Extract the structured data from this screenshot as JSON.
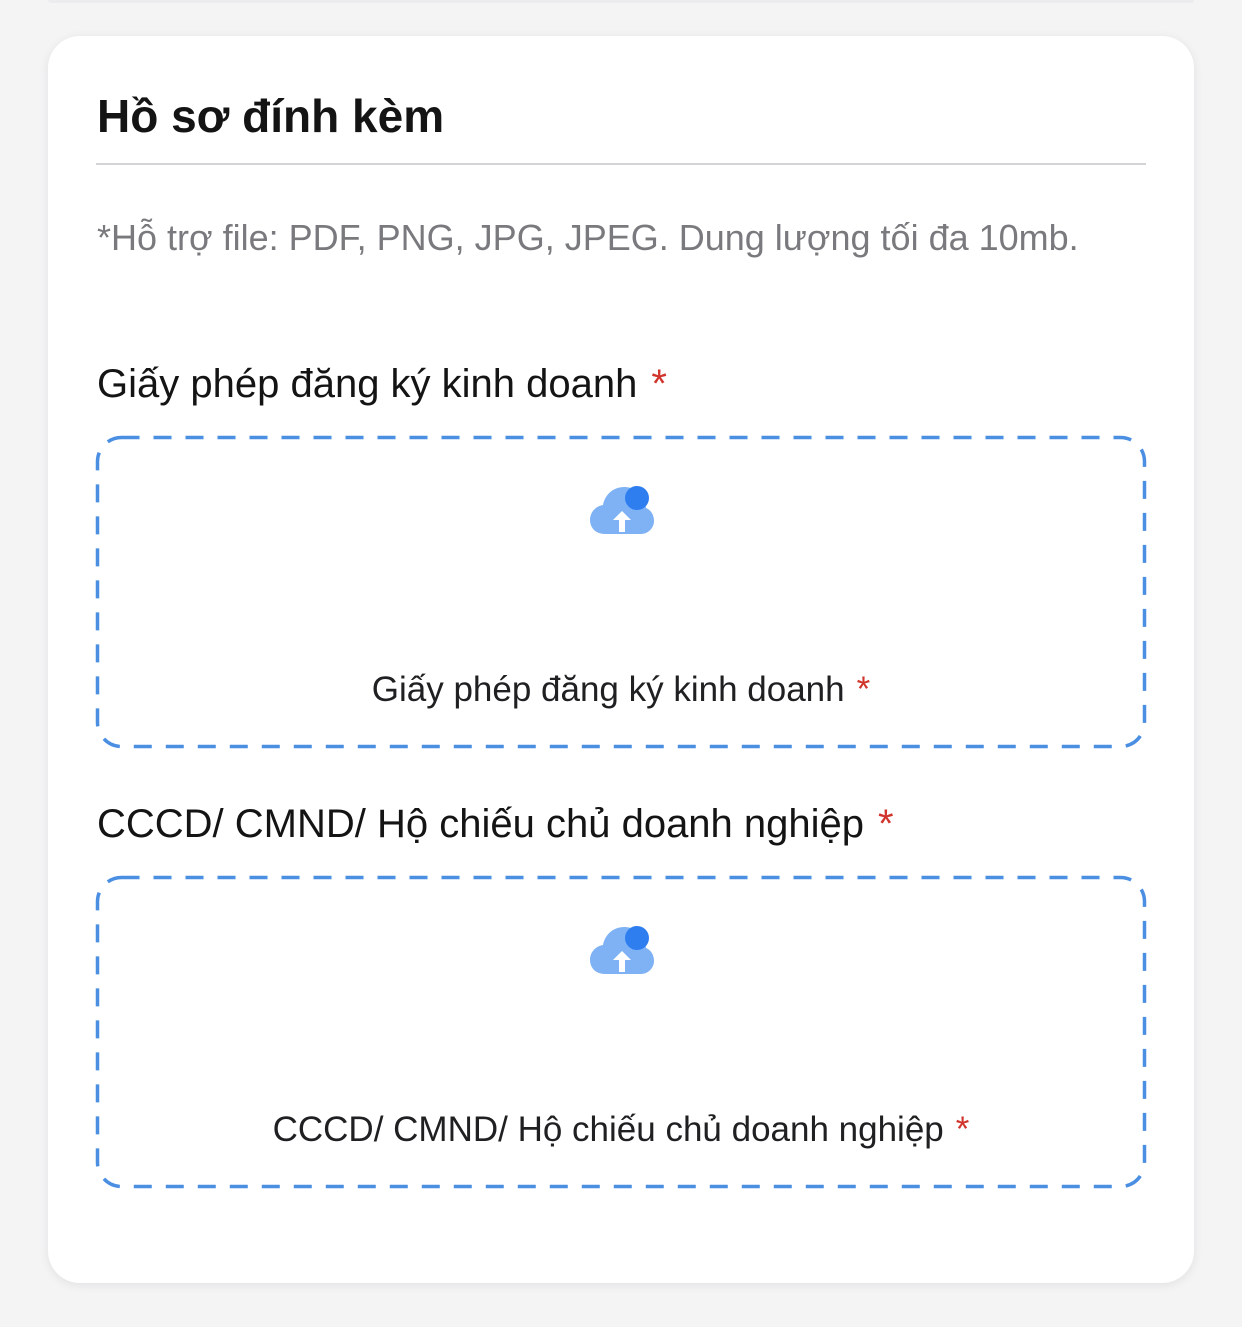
{
  "section": {
    "title": "Hồ sơ đính kèm",
    "support_note": "*Hỗ trợ file: PDF, PNG, JPG, JPEG. Dung lượng tối đa 10mb."
  },
  "fields": [
    {
      "label": "Giấy phép đăng ký kinh doanh",
      "required_mark": "*",
      "upload_text": "Giấy phép đăng ký kinh doanh",
      "upload_icon": "cloud-upload-icon"
    },
    {
      "label": "CCCD/ CMND/ Hộ chiếu chủ doanh nghiệp",
      "required_mark": "*",
      "upload_text": "CCCD/ CMND/ Hộ chiếu chủ doanh nghiệp",
      "upload_icon": "cloud-upload-icon"
    }
  ],
  "colors": {
    "dashed_border": "#4a8fe2",
    "required_star": "#d0342c",
    "icon_light": "#7fb2f5",
    "icon_dark": "#2f7ef0",
    "note_text": "#7a7a7e"
  }
}
